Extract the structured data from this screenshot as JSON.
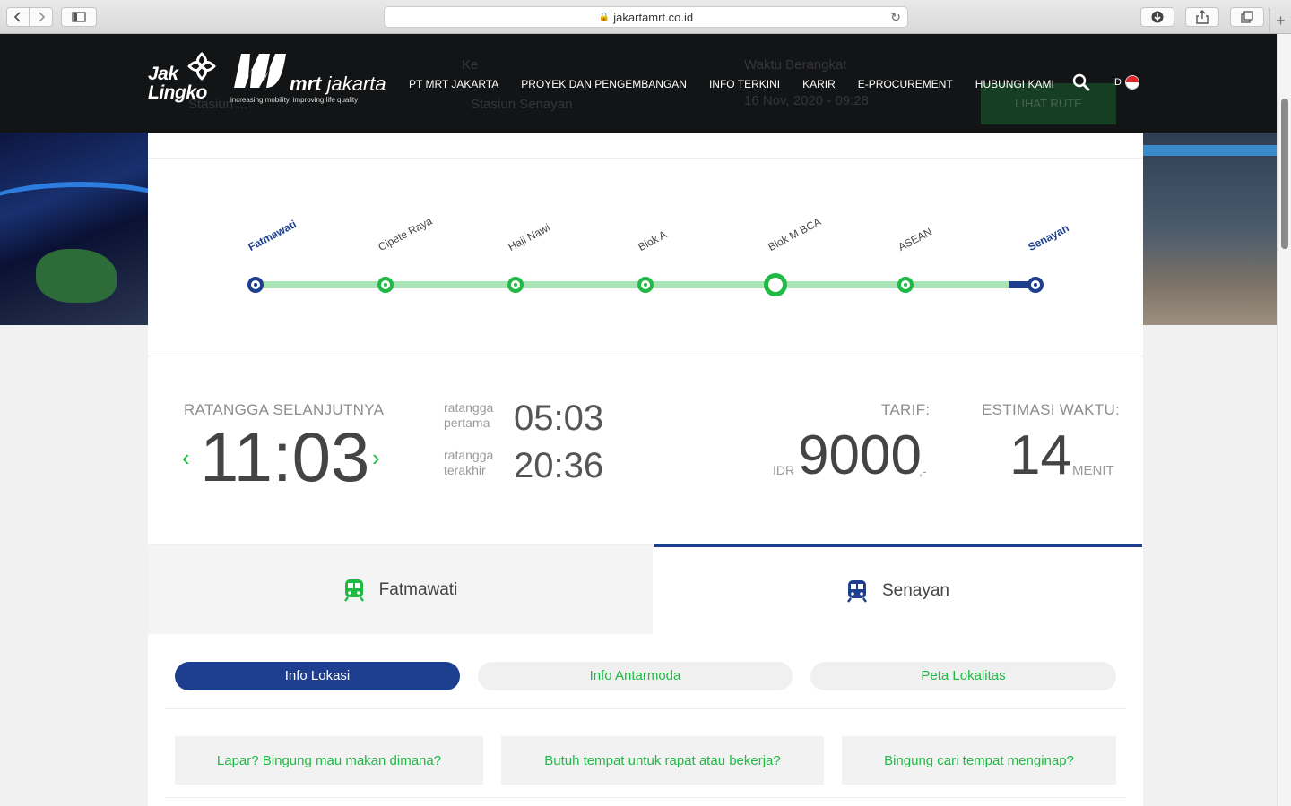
{
  "browser": {
    "url": "jakartamrt.co.id"
  },
  "header": {
    "jaklingko_line1": "Jak",
    "jaklingko_line2": "Lingko",
    "mrt_logo_text_bold": "mrt",
    "mrt_logo_text": " jakarta",
    "tagline": "increasing mobility, improving life quality",
    "menu": [
      {
        "label": "PT MRT JAKARTA"
      },
      {
        "label": "PROYEK DAN PENGEMBANGAN"
      },
      {
        "label": "INFO TERKINI"
      },
      {
        "label": "KARIR"
      },
      {
        "label": "E-PROCUREMENT"
      },
      {
        "label": "HUBUNGI KAMI"
      }
    ],
    "lang": "ID"
  },
  "search_form_behind": {
    "to_label": "Ke",
    "from_value": "Stasiun ...",
    "to_value": "Stasiun Senayan",
    "time_label": "Waktu Berangkat",
    "time_value": "16 Nov, 2020 - 09:28",
    "submit_label": "LIHAT RUTE"
  },
  "route": {
    "stations": [
      {
        "name": "Fatmawati",
        "terminal": true
      },
      {
        "name": "Cipete Raya",
        "terminal": false
      },
      {
        "name": "Haji Nawi",
        "terminal": false
      },
      {
        "name": "Blok A",
        "terminal": false
      },
      {
        "name": "Blok M BCA",
        "terminal": false,
        "current": true
      },
      {
        "name": "ASEAN",
        "terminal": false
      },
      {
        "name": "Senayan",
        "terminal": true
      }
    ]
  },
  "schedule": {
    "next_label": "RATANGGA SELANJUTNYA",
    "next_time": "11:03",
    "first_label_1": "ratangga",
    "first_label_2": "pertama",
    "first_time": "05:03",
    "last_label_1": "ratangga",
    "last_label_2": "terakhir",
    "last_time": "20:36",
    "prev_arrow": "‹",
    "next_arrow": "›"
  },
  "fare": {
    "label": "TARIF:",
    "currency": "IDR",
    "amount": "9000",
    "suffix": ",-"
  },
  "estimate": {
    "label": "ESTIMASI WAKTU:",
    "value": "14",
    "unit": "MENIT"
  },
  "direction_tabs": [
    {
      "label": "Fatmawati",
      "active": false,
      "icon_color": "#1fba45"
    },
    {
      "label": "Senayan",
      "active": true,
      "icon_color": "#1e3f8f"
    }
  ],
  "info_tabs": [
    {
      "label": "Info Lokasi",
      "active": true
    },
    {
      "label": "Info Antarmoda",
      "active": false
    },
    {
      "label": "Peta Lokalitas",
      "active": false
    }
  ],
  "questions": [
    {
      "label": "Lapar? Bingung mau makan dimana?"
    },
    {
      "label": "Butuh tempat untuk rapat atau bekerja?"
    },
    {
      "label": "Bingung cari tempat menginap?"
    }
  ],
  "colors": {
    "brand_blue": "#1e3f8f",
    "brand_green": "#1fba45",
    "track_green": "#a8e4b6"
  }
}
